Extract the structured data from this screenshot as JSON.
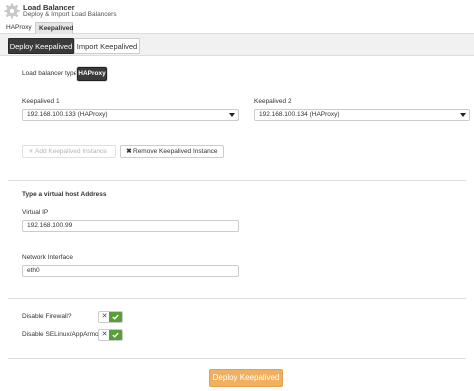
{
  "app": {
    "title": "Load Balancer",
    "subtitle": "Deploy & Import Load Balancers"
  },
  "subtabs": [
    {
      "label": "HAProxy"
    },
    {
      "label": "Keepalived"
    }
  ],
  "tabs": [
    {
      "label": "Deploy Keepalived",
      "active": true
    },
    {
      "label": "Import Keepalived",
      "active": false
    }
  ],
  "form": {
    "lb_type_label": "Load balancer type",
    "lb_type_value": "HAProxy",
    "keepalived1_label": "Keepalived 1",
    "keepalived1_value": "192.168.100.133 (HAProxy)",
    "keepalived2_label": "Keepalived 2",
    "keepalived2_value": "192.168.100.134 (HAProxy)",
    "add_instance_label": "Add Keepalived Instance",
    "remove_instance_label": "Remove Keepalived Instance",
    "vhost_heading": "Type a virtual host Address",
    "vip_label": "Virtual IP",
    "vip_value": "192.168.100.99",
    "iface_label": "Network Interface",
    "iface_value": "eth0",
    "firewall_label": "Disable Firewall?",
    "selinux_label": "Disable SELinux/AppArmor?",
    "toggle_off_glyph": "✕",
    "deploy_label": "Deploy Keepalived"
  },
  "colors": {
    "accent_dark": "#3a3a3a",
    "toggle_on": "#5a9e3a",
    "deploy_button": "#f0b060"
  }
}
